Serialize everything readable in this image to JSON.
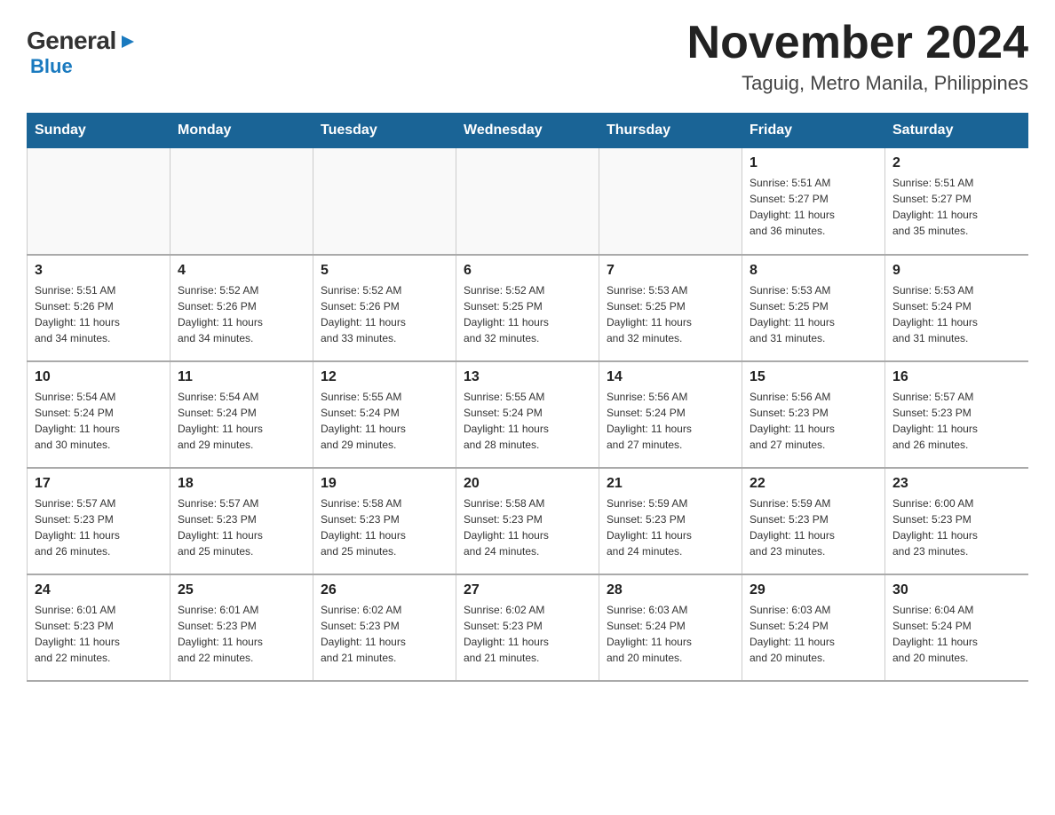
{
  "header": {
    "logo_general": "General",
    "logo_blue": "Blue",
    "title": "November 2024",
    "subtitle": "Taguig, Metro Manila, Philippines"
  },
  "weekdays": [
    "Sunday",
    "Monday",
    "Tuesday",
    "Wednesday",
    "Thursday",
    "Friday",
    "Saturday"
  ],
  "weeks": [
    [
      {
        "day": "",
        "info": ""
      },
      {
        "day": "",
        "info": ""
      },
      {
        "day": "",
        "info": ""
      },
      {
        "day": "",
        "info": ""
      },
      {
        "day": "",
        "info": ""
      },
      {
        "day": "1",
        "info": "Sunrise: 5:51 AM\nSunset: 5:27 PM\nDaylight: 11 hours\nand 36 minutes."
      },
      {
        "day": "2",
        "info": "Sunrise: 5:51 AM\nSunset: 5:27 PM\nDaylight: 11 hours\nand 35 minutes."
      }
    ],
    [
      {
        "day": "3",
        "info": "Sunrise: 5:51 AM\nSunset: 5:26 PM\nDaylight: 11 hours\nand 34 minutes."
      },
      {
        "day": "4",
        "info": "Sunrise: 5:52 AM\nSunset: 5:26 PM\nDaylight: 11 hours\nand 34 minutes."
      },
      {
        "day": "5",
        "info": "Sunrise: 5:52 AM\nSunset: 5:26 PM\nDaylight: 11 hours\nand 33 minutes."
      },
      {
        "day": "6",
        "info": "Sunrise: 5:52 AM\nSunset: 5:25 PM\nDaylight: 11 hours\nand 32 minutes."
      },
      {
        "day": "7",
        "info": "Sunrise: 5:53 AM\nSunset: 5:25 PM\nDaylight: 11 hours\nand 32 minutes."
      },
      {
        "day": "8",
        "info": "Sunrise: 5:53 AM\nSunset: 5:25 PM\nDaylight: 11 hours\nand 31 minutes."
      },
      {
        "day": "9",
        "info": "Sunrise: 5:53 AM\nSunset: 5:24 PM\nDaylight: 11 hours\nand 31 minutes."
      }
    ],
    [
      {
        "day": "10",
        "info": "Sunrise: 5:54 AM\nSunset: 5:24 PM\nDaylight: 11 hours\nand 30 minutes."
      },
      {
        "day": "11",
        "info": "Sunrise: 5:54 AM\nSunset: 5:24 PM\nDaylight: 11 hours\nand 29 minutes."
      },
      {
        "day": "12",
        "info": "Sunrise: 5:55 AM\nSunset: 5:24 PM\nDaylight: 11 hours\nand 29 minutes."
      },
      {
        "day": "13",
        "info": "Sunrise: 5:55 AM\nSunset: 5:24 PM\nDaylight: 11 hours\nand 28 minutes."
      },
      {
        "day": "14",
        "info": "Sunrise: 5:56 AM\nSunset: 5:24 PM\nDaylight: 11 hours\nand 27 minutes."
      },
      {
        "day": "15",
        "info": "Sunrise: 5:56 AM\nSunset: 5:23 PM\nDaylight: 11 hours\nand 27 minutes."
      },
      {
        "day": "16",
        "info": "Sunrise: 5:57 AM\nSunset: 5:23 PM\nDaylight: 11 hours\nand 26 minutes."
      }
    ],
    [
      {
        "day": "17",
        "info": "Sunrise: 5:57 AM\nSunset: 5:23 PM\nDaylight: 11 hours\nand 26 minutes."
      },
      {
        "day": "18",
        "info": "Sunrise: 5:57 AM\nSunset: 5:23 PM\nDaylight: 11 hours\nand 25 minutes."
      },
      {
        "day": "19",
        "info": "Sunrise: 5:58 AM\nSunset: 5:23 PM\nDaylight: 11 hours\nand 25 minutes."
      },
      {
        "day": "20",
        "info": "Sunrise: 5:58 AM\nSunset: 5:23 PM\nDaylight: 11 hours\nand 24 minutes."
      },
      {
        "day": "21",
        "info": "Sunrise: 5:59 AM\nSunset: 5:23 PM\nDaylight: 11 hours\nand 24 minutes."
      },
      {
        "day": "22",
        "info": "Sunrise: 5:59 AM\nSunset: 5:23 PM\nDaylight: 11 hours\nand 23 minutes."
      },
      {
        "day": "23",
        "info": "Sunrise: 6:00 AM\nSunset: 5:23 PM\nDaylight: 11 hours\nand 23 minutes."
      }
    ],
    [
      {
        "day": "24",
        "info": "Sunrise: 6:01 AM\nSunset: 5:23 PM\nDaylight: 11 hours\nand 22 minutes."
      },
      {
        "day": "25",
        "info": "Sunrise: 6:01 AM\nSunset: 5:23 PM\nDaylight: 11 hours\nand 22 minutes."
      },
      {
        "day": "26",
        "info": "Sunrise: 6:02 AM\nSunset: 5:23 PM\nDaylight: 11 hours\nand 21 minutes."
      },
      {
        "day": "27",
        "info": "Sunrise: 6:02 AM\nSunset: 5:23 PM\nDaylight: 11 hours\nand 21 minutes."
      },
      {
        "day": "28",
        "info": "Sunrise: 6:03 AM\nSunset: 5:24 PM\nDaylight: 11 hours\nand 20 minutes."
      },
      {
        "day": "29",
        "info": "Sunrise: 6:03 AM\nSunset: 5:24 PM\nDaylight: 11 hours\nand 20 minutes."
      },
      {
        "day": "30",
        "info": "Sunrise: 6:04 AM\nSunset: 5:24 PM\nDaylight: 11 hours\nand 20 minutes."
      }
    ]
  ]
}
